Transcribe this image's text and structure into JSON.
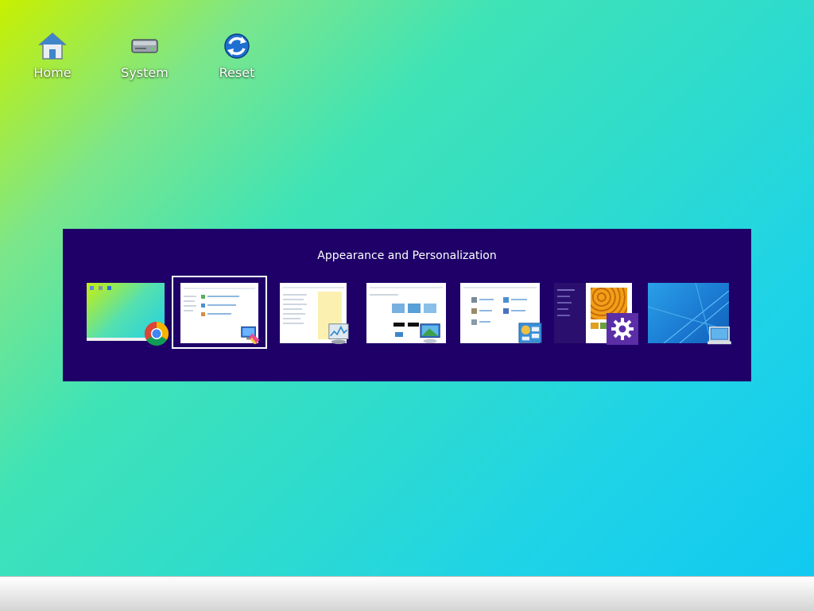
{
  "desktop": {
    "icons": [
      {
        "label": "Home",
        "icon": "home-icon"
      },
      {
        "label": "System",
        "icon": "system-drive-icon"
      },
      {
        "label": "Reset",
        "icon": "reset-icon"
      }
    ]
  },
  "switcher": {
    "title": "Appearance and Personalization",
    "selected_index": 1,
    "windows": [
      {
        "app_icon": "chrome-icon"
      },
      {
        "app_icon": "appearance-personalization-icon"
      },
      {
        "app_icon": "task-manager-icon"
      },
      {
        "app_icon": "display-settings-icon"
      },
      {
        "app_icon": "control-panel-icon"
      },
      {
        "app_icon": "settings-gear-icon"
      },
      {
        "app_icon": "desktop-icon"
      }
    ]
  },
  "colors": {
    "switcher_bg": "#1e0068",
    "settings_purple": "#5b2ea8"
  }
}
